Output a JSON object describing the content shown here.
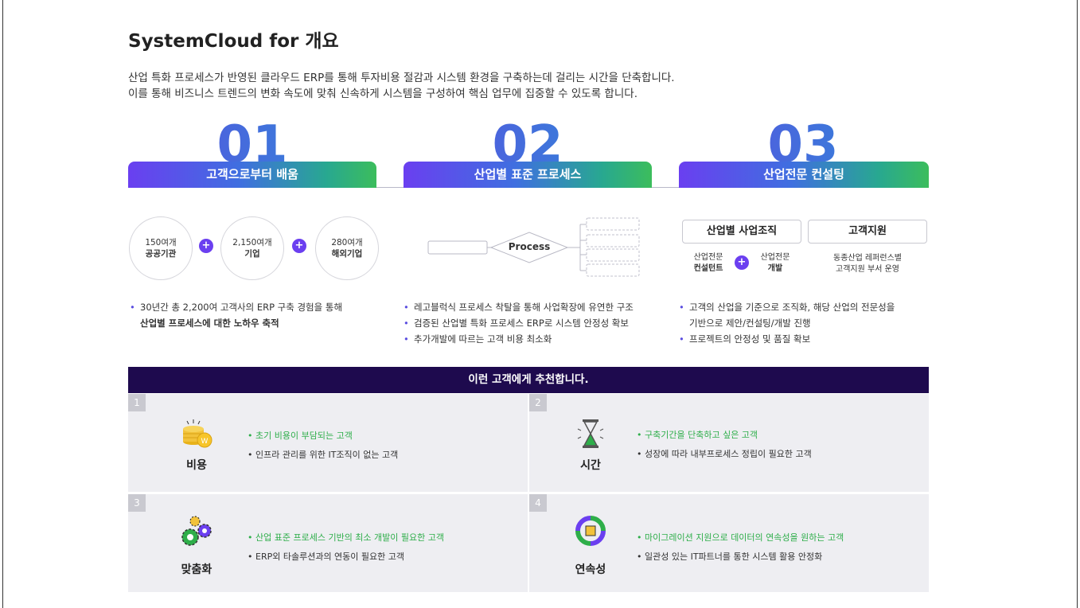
{
  "page": {
    "title": "SystemCloud for 개요",
    "intro": [
      "산업 특화 프로세스가 반영된 클라우드 ERP를 통해 투자비용 절감과 시스템 환경을 구축하는데 걸리는 시간을 단축합니다.",
      "이를 통해 비즈니스 트렌드의 변화 속도에 맞춰 신속하게 시스템을 구성하여 핵심 업무에 집중할 수 있도록 합니다."
    ]
  },
  "columns": [
    {
      "number": "01",
      "heading": "고객으로부터 배움",
      "circles": [
        {
          "top": "150여개",
          "bottom": "공공기관"
        },
        {
          "top": "2,150여개",
          "bottom": "기업"
        },
        {
          "top": "280여개",
          "bottom": "해외기업"
        }
      ],
      "plus": "+",
      "bullets": [
        "30년간 총 2,200여 고객사의 ERP 구축 경험을 통해",
        "산업별 프로세스에 대한 노하우 축적"
      ]
    },
    {
      "number": "02",
      "heading": "산업별 표준 프로세스",
      "process_label": "Process",
      "bullets": [
        "레고블럭식 프로세스 착탈을 통해 사업확장에 유연한 구조",
        "검증된 산업별 특화 프로세스 ERP로 시스템 안정성 확보",
        "추가개발에 따르는 고객 비용 최소화"
      ]
    },
    {
      "number": "03",
      "heading": "산업전문 컨설팅",
      "box_left": "산업별 사업조직",
      "box_right": "고객지원",
      "sub_left_a": [
        "산업전문",
        "컨설턴트"
      ],
      "sub_left_b": [
        "산업전문",
        "개발"
      ],
      "sub_right": [
        "동종산업 레퍼런스별",
        "고객지원 부서 운영"
      ],
      "plus": "+",
      "bullets": [
        "고객의 산업을 기준으로 조직화, 해당 산업의 전문성을",
        "기반으로 제안/컨설팅/개발 진행",
        "프로젝트의 안정성 및 품질 확보"
      ]
    }
  ],
  "recommend": {
    "header": "이런 고객에게 추천합니다.",
    "cells": [
      {
        "num": "1",
        "label": "비용",
        "icon": "coins-icon",
        "highlight": "초기 비용이 부담되는 고객",
        "line": "인프라 관리를 위한 IT조직이 없는 고객"
      },
      {
        "num": "2",
        "label": "시간",
        "icon": "hourglass-icon",
        "highlight": "구축기간을 단축하고 싶은 고객",
        "line": "성장에 따라 내부프로세스 정립이 필요한 고객"
      },
      {
        "num": "3",
        "label": "맞춤화",
        "icon": "gears-icon",
        "highlight": "산업 표준 프로세스 기반의 최소 개발이 필요한 고객",
        "line": "ERP외 타솔루션과의 연동이 필요한 고객"
      },
      {
        "num": "4",
        "label": "연속성",
        "icon": "cycle-icon",
        "highlight": "마이그레이션 지원으로 데이터의 연속성을 원하는 고객",
        "line": "일관성 있는 IT파트너를 통한 시스템 활용 안정화"
      }
    ]
  },
  "colors": {
    "purple": "#6b3ff0",
    "green": "#3cbd5c",
    "navy": "#1e0a4e"
  }
}
